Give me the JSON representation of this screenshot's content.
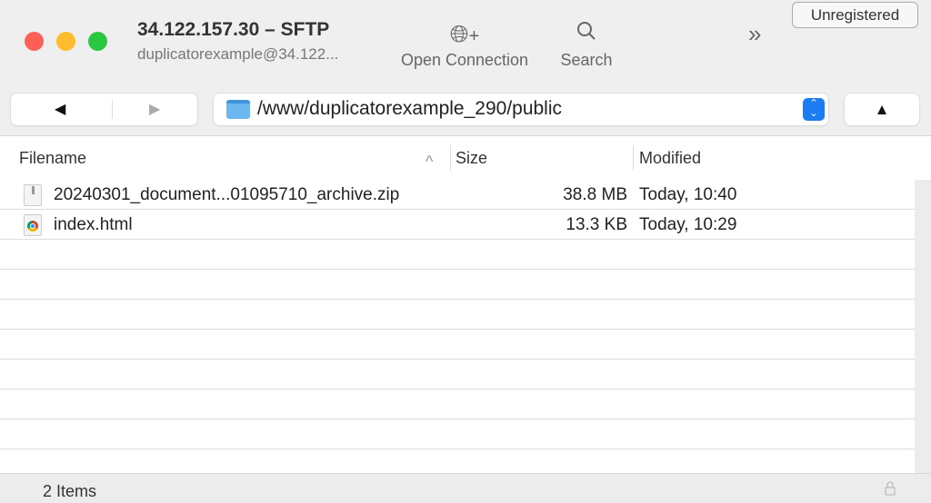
{
  "window": {
    "title": "34.122.157.30 – SFTP",
    "subtitle": "duplicatorexample@34.122...",
    "colors": {
      "close": "#fe5f57",
      "minimize": "#febc2e",
      "zoom": "#28c840"
    }
  },
  "toolbar": {
    "open_connection": "Open Connection",
    "search": "Search",
    "unregistered": "Unregistered",
    "more": "»"
  },
  "nav": {
    "back": "◀",
    "forward": "▶",
    "path": "/www/duplicatorexample_290/public",
    "up": "▲"
  },
  "columns": {
    "filename": "Filename",
    "size": "Size",
    "modified": "Modified",
    "sort": "^"
  },
  "files": [
    {
      "name": "20240301_document...01095710_archive.zip",
      "size": "38.8 MB",
      "modified": "Today, 10:40",
      "icon": "zip-icon"
    },
    {
      "name": "index.html",
      "size": "13.3 KB",
      "modified": "Today, 10:29",
      "icon": "chrome-html-icon"
    }
  ],
  "status": {
    "count": "2 Items"
  }
}
